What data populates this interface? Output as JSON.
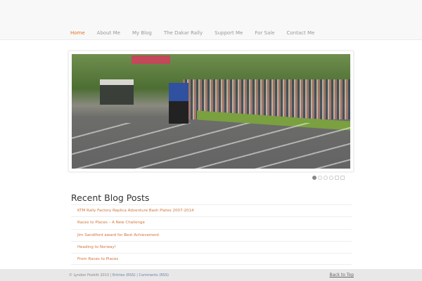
{
  "nav": [
    "Home",
    "About Me",
    "My Blog",
    "The Dakar Rally",
    "Support Me",
    "For Sale",
    "Contact Me"
  ],
  "recent": {
    "title": "Recent Blog Posts",
    "posts": [
      "KTM Rally Factory Replica Adventure Bash Plates 2007-2014",
      "Races to Places – A New Challenge",
      "Jim Sandiford award for Best Achievement",
      "Heading to Norway!",
      "From Races to Places"
    ]
  },
  "footer": {
    "copyright": "© Lyndon Poskitt 2013 |",
    "entries": "Entries (RSS)",
    "sep": "|",
    "comments": "Comments (RSS)",
    "back_to_top": "Back to Top"
  }
}
